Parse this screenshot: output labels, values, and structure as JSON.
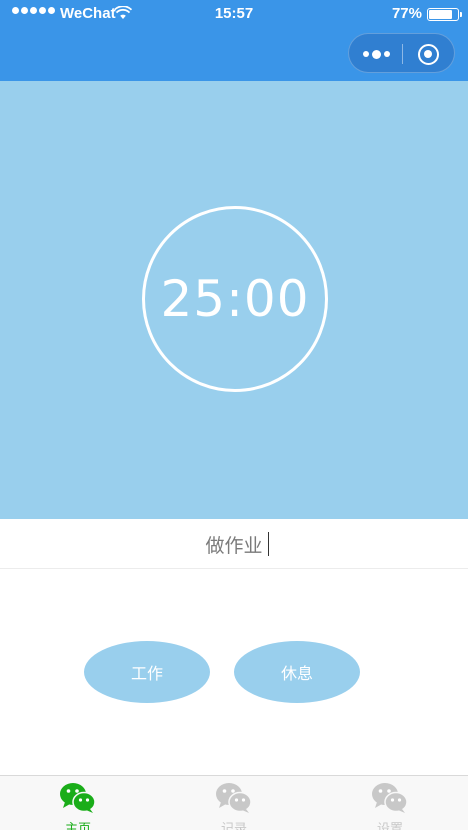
{
  "status_bar": {
    "carrier": "WeChat",
    "time": "15:57",
    "battery_percent": "77%",
    "battery_level": 0.77
  },
  "colors": {
    "nav_blue": "#3a95e8",
    "panel_blue": "#99cfed",
    "tab_active": "#1aad19",
    "tab_inactive": "#c8c8c8"
  },
  "timer": {
    "display": "25:00"
  },
  "task": {
    "value": "做作业"
  },
  "buttons": {
    "work_label": "工作",
    "rest_label": "休息"
  },
  "tabs": [
    {
      "label": "主页",
      "icon": "wechat-chat-icon",
      "active": true
    },
    {
      "label": "记录",
      "icon": "wechat-chat-icon",
      "active": false
    },
    {
      "label": "设置",
      "icon": "wechat-chat-icon",
      "active": false
    }
  ]
}
